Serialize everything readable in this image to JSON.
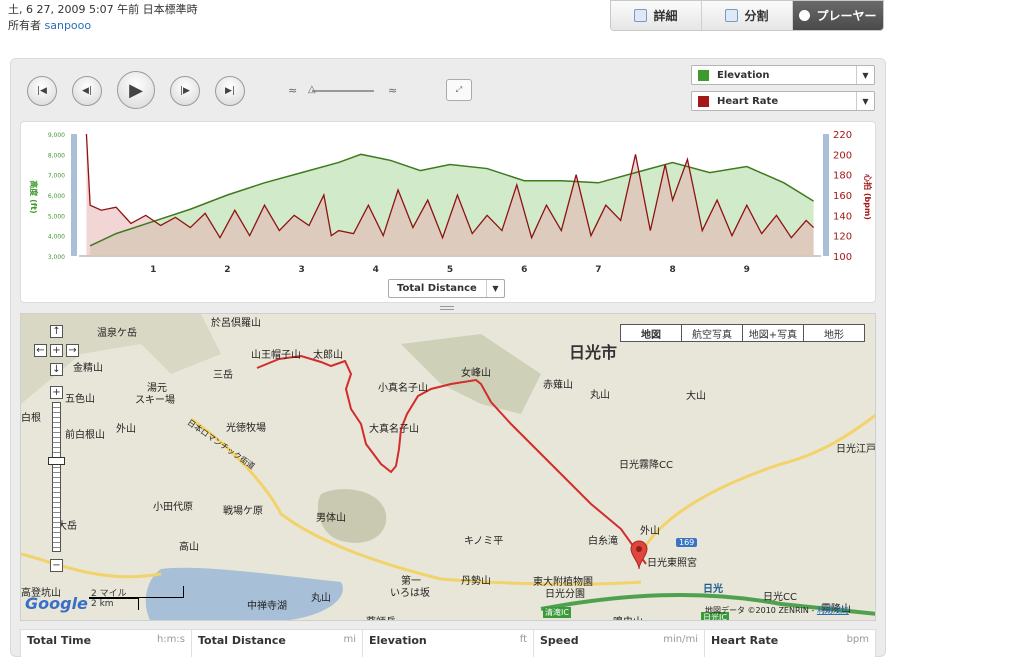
{
  "header": {
    "date_line": "土, 6 27, 2009 5:07 午前 日本標準時",
    "owner_label": "所有者",
    "owner_name": "sanpooo"
  },
  "tabs": [
    {
      "label": "詳細",
      "icon": "document-icon",
      "active": false
    },
    {
      "label": "分割",
      "icon": "table-icon",
      "active": false
    },
    {
      "label": "プレーヤー",
      "icon": "play-circle-icon",
      "active": true
    }
  ],
  "player": {
    "buttons": [
      "first",
      "prev",
      "play",
      "next",
      "last"
    ],
    "speed_slow_icon": "turtle-icon",
    "speed_fast_icon": "rabbit-icon",
    "fullscreen_icon": "fullscreen-icon"
  },
  "selectors": {
    "primary": {
      "label": "Elevation",
      "color": "#3f9a2e"
    },
    "secondary": {
      "label": "Heart Rate",
      "color": "#a31818"
    }
  },
  "chart_data": {
    "type": "area",
    "x_axis_button": "Total Distance",
    "xlim": [
      0,
      10
    ],
    "x_ticks": [
      "1",
      "2",
      "3",
      "4",
      "5",
      "6",
      "7",
      "8",
      "9"
    ],
    "left_axis": {
      "label": "高度 (ft)",
      "ticks": [
        "9,000",
        "8,000",
        "7,000",
        "6,000",
        "5,000",
        "4,000",
        "3,000"
      ],
      "ylim": [
        3000,
        9000
      ],
      "color": "#3f9a2e"
    },
    "right_axis": {
      "label": "心拍 (bpm)",
      "ticks": [
        "220",
        "200",
        "180",
        "160",
        "140",
        "120",
        "100"
      ],
      "ylim": [
        100,
        220
      ],
      "color": "#a31818"
    },
    "series": [
      {
        "name": "Elevation",
        "x": [
          0.15,
          0.5,
          1.0,
          1.5,
          2.0,
          2.5,
          3.0,
          3.5,
          3.8,
          4.2,
          4.6,
          5.0,
          5.5,
          6.0,
          6.5,
          7.0,
          7.5,
          8.0,
          8.5,
          9.0,
          9.5,
          9.9
        ],
        "y": [
          3500,
          4100,
          4700,
          5300,
          6000,
          6600,
          7100,
          7600,
          8000,
          7700,
          7200,
          7500,
          7300,
          6700,
          6700,
          6600,
          7100,
          7600,
          7100,
          7400,
          6600,
          5700
        ]
      },
      {
        "name": "Heart Rate",
        "x": [
          0.1,
          0.15,
          0.3,
          0.5,
          0.7,
          0.9,
          1.1,
          1.3,
          1.5,
          1.7,
          1.9,
          2.1,
          2.3,
          2.5,
          2.7,
          2.9,
          3.1,
          3.3,
          3.4,
          3.5,
          3.7,
          3.9,
          4.1,
          4.3,
          4.5,
          4.7,
          4.9,
          5.1,
          5.3,
          5.5,
          5.7,
          5.9,
          6.1,
          6.3,
          6.5,
          6.7,
          6.9,
          7.1,
          7.3,
          7.5,
          7.7,
          7.9,
          8.0,
          8.2,
          8.4,
          8.6,
          8.8,
          9.0,
          9.2,
          9.4,
          9.6,
          9.8,
          9.9
        ],
        "y": [
          220,
          150,
          145,
          148,
          132,
          140,
          130,
          138,
          128,
          142,
          118,
          145,
          120,
          150,
          125,
          140,
          130,
          160,
          120,
          125,
          122,
          150,
          120,
          165,
          128,
          155,
          118,
          160,
          122,
          140,
          125,
          170,
          118,
          150,
          125,
          180,
          120,
          150,
          135,
          200,
          125,
          190,
          155,
          195,
          125,
          155,
          120,
          150,
          122,
          140,
          118,
          135,
          128
        ]
      }
    ]
  },
  "map": {
    "type_buttons": [
      "地図",
      "航空写真",
      "地図+写真",
      "地形"
    ],
    "active_type": "地図",
    "labels": [
      {
        "text": "日光市",
        "big": true
      },
      {
        "text": "温泉ケ岳"
      },
      {
        "text": "於呂倶羅山"
      },
      {
        "text": "山王帽子山"
      },
      {
        "text": "太郎山"
      },
      {
        "text": "女峰山"
      },
      {
        "text": "小真名子山"
      },
      {
        "text": "大真名子山"
      },
      {
        "text": "赤薙山"
      },
      {
        "text": "丸山"
      },
      {
        "text": "大山"
      },
      {
        "text": "日光江戸"
      },
      {
        "text": "金精山"
      },
      {
        "text": "湯元"
      },
      {
        "text": "スキー場"
      },
      {
        "text": "三岳"
      },
      {
        "text": "五色山"
      },
      {
        "text": "白根"
      },
      {
        "text": "前白根山"
      },
      {
        "text": "外山"
      },
      {
        "text": "光徳牧場"
      },
      {
        "text": "日本ロマンチック街道"
      },
      {
        "text": "日光霧降CC"
      },
      {
        "text": "小田代原"
      },
      {
        "text": "戦場ケ原"
      },
      {
        "text": "男体山"
      },
      {
        "text": "大岳"
      },
      {
        "text": "高山"
      },
      {
        "text": "キノミ平"
      },
      {
        "text": "白糸滝"
      },
      {
        "text": "外山"
      },
      {
        "text": "日光東照宮"
      },
      {
        "text": "第一"
      },
      {
        "text": "いろは坂"
      },
      {
        "text": "丹勢山"
      },
      {
        "text": "東大附植物園"
      },
      {
        "text": "日光分園"
      },
      {
        "text": "日光"
      },
      {
        "text": "日光CC"
      },
      {
        "text": "中禅寺湖"
      },
      {
        "text": "丸山"
      },
      {
        "text": "薬師岳"
      },
      {
        "text": "高登坑山"
      },
      {
        "text": "清滝IC"
      },
      {
        "text": "日光IC"
      },
      {
        "text": "鳴虫山"
      },
      {
        "text": "霧降山"
      }
    ],
    "route_badge": "169",
    "scale_top": "2 マイル",
    "scale_bottom": "2 km",
    "logo": "Google",
    "attribution": "地図データ ©2010 ZENRIN - ",
    "terms": "利用規約"
  },
  "stats": [
    {
      "label": "Total Time",
      "unit": "h:m:s"
    },
    {
      "label": "Total Distance",
      "unit": "mi"
    },
    {
      "label": "Elevation",
      "unit": "ft"
    },
    {
      "label": "Speed",
      "unit": "min/mi"
    },
    {
      "label": "Heart Rate",
      "unit": "bpm"
    }
  ]
}
